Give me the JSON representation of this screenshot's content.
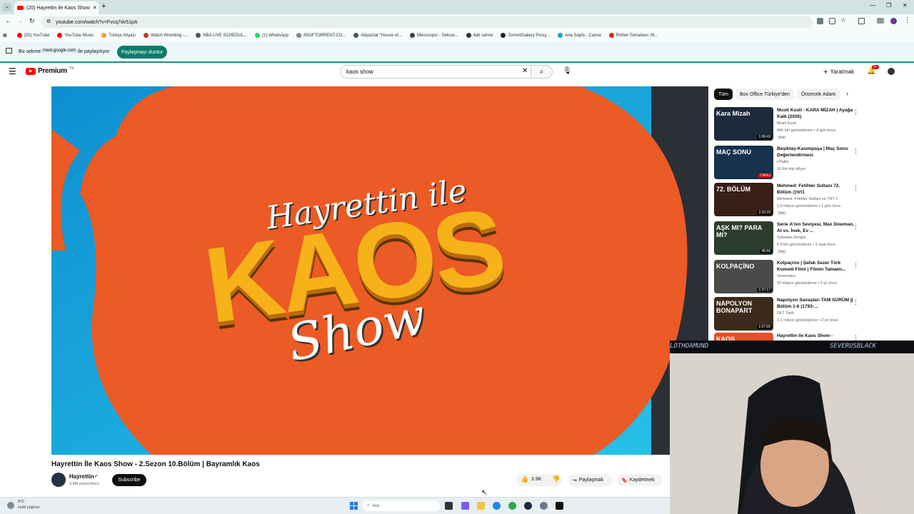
{
  "browser": {
    "tab_title": "(20) Hayrettin ile Kaos Show",
    "url": "youtube.com/watch?v=Fvcq7dv51pA",
    "bookmarks": [
      {
        "label": "(20) YouTube",
        "color": "#ff0000"
      },
      {
        "label": "YouTube Music",
        "color": "#ff0000"
      },
      {
        "label": "Türkçe Altyazı",
        "color": "#e8a33c"
      },
      {
        "label": "Watch Wrestling -...",
        "color": "#c0392b"
      },
      {
        "label": "NBA LIVE SCHEDUL...",
        "color": "#555555"
      },
      {
        "label": "(1) WhatsApp",
        "color": "#25d366"
      },
      {
        "label": "4SOFTORRENT.CO...",
        "color": "#888888"
      },
      {
        "label": "Altyazılar \"House of...",
        "color": "#555555"
      },
      {
        "label": "Mevzuspor - Selcuk...",
        "color": "#444444"
      },
      {
        "label": "4alt sahne",
        "color": "#333333"
      },
      {
        "label": "TorrentGalaxy Proxy...",
        "color": "#222222"
      },
      {
        "label": "Ana Sayfa - Canva",
        "color": "#1fa2e0"
      },
      {
        "label": "Rotten Tomatoes: M...",
        "color": "#d62b12"
      }
    ]
  },
  "share_banner": {
    "text_prefix": "Bu sekme",
    "host": "meet.google.com",
    "text_suffix": "ile paylaşılıyor",
    "stop_label": "Paylaşmayı durdur"
  },
  "youtube": {
    "logo_label": "Premium",
    "logo_badge": "TR",
    "search_value": "kaos show",
    "create_label": "Yaratmak",
    "notif_count": "9+",
    "video": {
      "title": "Hayrettin İle Kaos Show - 2.Sezon 10.Bölüm | Bayramlık Kaos",
      "thumb_line1": "Hayrettin ile",
      "thumb_line2": "KAOS",
      "thumb_line3": "Show",
      "channel": "Hayrettin",
      "subscribers": "3.4M subscribers",
      "subscribe_label": "Subscribe",
      "likes": "3.9K",
      "share_label": "Paylaşmak",
      "save_label": "Kaydetmek"
    },
    "chips": [
      "Tüm",
      "Box Office Türkiye'den",
      "Örümcek Adam"
    ],
    "recommendations": [
      {
        "title": "Musti Kusti - KARA MİZAH | Ayağa Kalk (2026)",
        "channel": "Musti Kusti",
        "meta": "845 bin görüntüleme • 4 gün önce",
        "duration": "1:08:49",
        "new": "Yeni",
        "thumb_text": "Kara Mizah",
        "color": "#1c2a3a"
      },
      {
        "title": "Beşiktaş-Kasımpaşa | Maç Sonu Değerlendirmesi",
        "channel": "HTalks",
        "meta": "16 bin kişi izliyor",
        "duration": "CANLI",
        "new": "",
        "thumb_text": "MAÇ SONU",
        "color": "#16324f"
      },
      {
        "title": "Mehmed: Fetihler Sultanı 72. Bölüm @trt1",
        "channel": "Mehmed: Fetihler Sultanı ve TRT 1",
        "meta": "1,5 milyon görüntüleme • 1 gün önce",
        "duration": "2:20:29",
        "new": "Yeni",
        "thumb_text": "72. BÖLÜM",
        "color": "#3a1e18"
      },
      {
        "title": "Serie A'nın Seviyesi, Max Dowman, At vs. İnek, Ev ...",
        "channel": "Sokrates Dergisi",
        "meta": "5,6 bin görüntüleme • 3 saat önce",
        "duration": "45:56",
        "new": "Yeni",
        "thumb_text": "AŞK MI? PARA MI?",
        "color": "#2b3d2b"
      },
      {
        "title": "Kolpaçino | Şafak Sezer Türk Komedi Filmi | Filmin Tamamı...",
        "channel": "Sinemaloo",
        "meta": "33 milyon görüntüleme • 9 yıl önce",
        "duration": "1:37:17",
        "new": "",
        "thumb_text": "KOLPAÇİNO",
        "color": "#4a4a4a"
      },
      {
        "title": "Napolyon Savaşları TAM SÜRÜM || Bölüm 1-6 (1793-...",
        "channel": "DFT Tarih",
        "meta": "1,1 milyon görüntüleme • 2 yıl önce",
        "duration": "1:57:09",
        "new": "",
        "thumb_text": "NAPOLYON BONAPART",
        "color": "#3c2a1a"
      },
      {
        "title": "Hayrettin ile Kaos Show -",
        "channel": "",
        "meta": "",
        "duration": "",
        "new": "",
        "thumb_text": "KAOS",
        "color": "#e2522a"
      }
    ]
  },
  "webcam": {
    "banner_left": "LOTHOAMUND",
    "banner_right": "SEVERUSBLACK"
  },
  "taskbar": {
    "weather_temp": "6°C",
    "weather_desc": "Hafif yağmur",
    "search_placeholder": "Ara"
  }
}
